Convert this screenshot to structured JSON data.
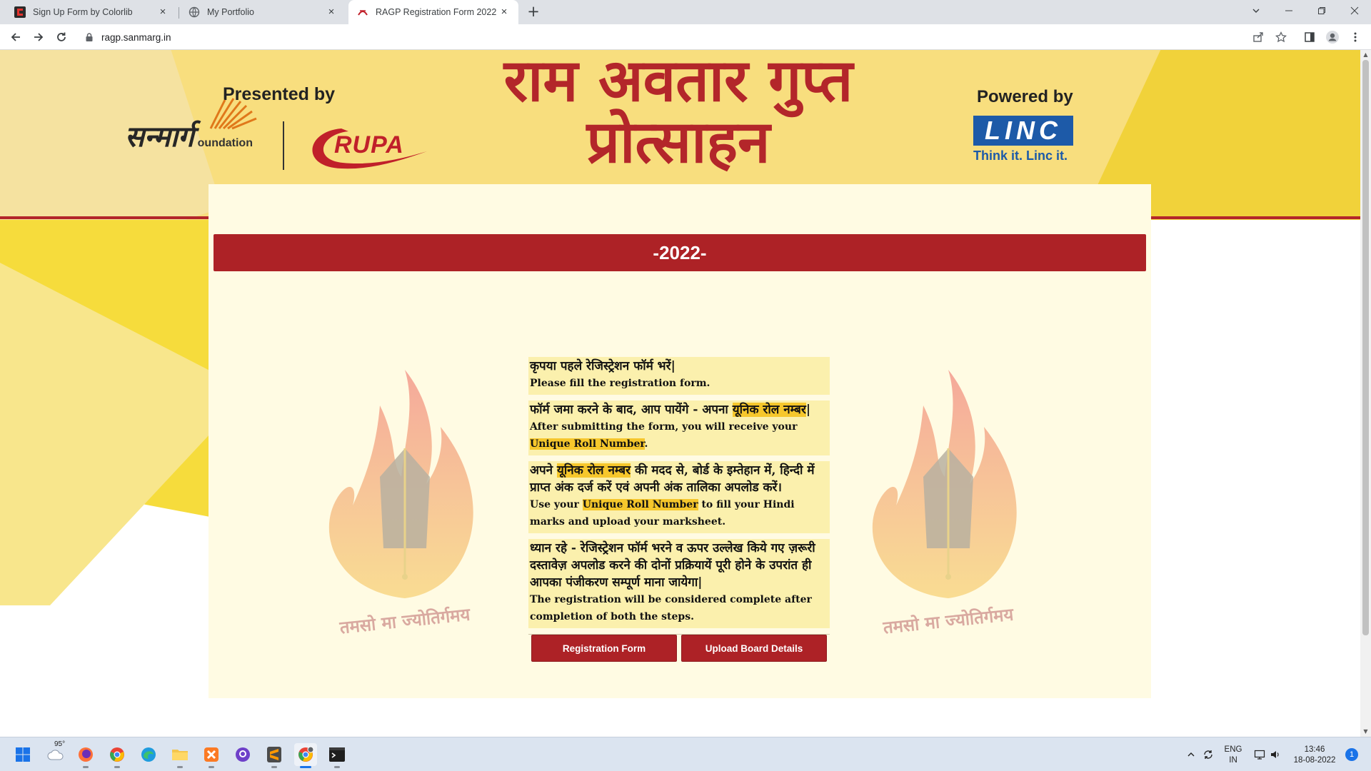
{
  "browser": {
    "tabs": [
      {
        "title": "Sign Up Form by Colorlib",
        "active": false
      },
      {
        "title": "My Portfolio",
        "active": false
      },
      {
        "title": "RAGP Registration Form 2022",
        "active": true
      }
    ],
    "url": "ragp.sanmarg.in",
    "accent": "#1a73e8"
  },
  "banner": {
    "presented_by": "Presented by",
    "sanmarg_logo_dev": "सन्मार्ग",
    "sanmarg_logo_eng": "oundation",
    "rupa_logo": "RUPA",
    "title_line1": "राम अवतार गुप्त",
    "title_line2": "प्रोत्साहन",
    "powered_by": "Powered by",
    "linc_logo": "LINC",
    "linc_tagline": "Think it. Linc it.",
    "colors": {
      "brand_red": "#ad2226",
      "banner_yellow": "#f8de7e",
      "linc_blue": "#1d5aa8"
    }
  },
  "year_banner": "-2022-",
  "emblem_motto": "तमसो मा ज्योतिर्गमय",
  "info": {
    "b1_hi": "कृपया पहले रेजिस्ट्रेशन फॉर्म भरें|",
    "b1_en": "Please fill the registration form.",
    "b2_hi_pre": "फॉर्म जमा करने के बाद, आप पायेंगे - अपना ",
    "b2_hi_hl": "यूनिक रोल नम्बर",
    "b2_hi_post": "|",
    "b2_en_pre": "After submitting the form, you will receive your ",
    "b2_en_hl": "Unique Roll Number",
    "b2_en_post": ".",
    "b3_hi_pre": "अपने ",
    "b3_hi_hl": "यूनिक रोल नम्बर",
    "b3_hi_post": " की मदद से, बोर्ड के इम्तेहान में, हिन्दी में प्राप्त अंक दर्ज करें एवं अपनी अंक तालिका अपलोड करें।",
    "b3_en_pre": "Use your ",
    "b3_en_hl": "Unique Roll Number",
    "b3_en_post": " to fill your Hindi marks and upload your marksheet.",
    "b4_hi": "ध्यान रहे - रेजिस्ट्रेशन फॉर्म भरने व ऊपर उल्लेख किये गए ज़रूरी दस्तावेज़ अपलोड करने की दोनों प्रक्रियायें पूरी होने के उपरांत ही आपका पंजीकरण सम्पूर्ण माना जायेगा|",
    "b4_en": "The registration will be considered complete after completion of both the steps."
  },
  "buttons": {
    "registration": "Registration Form",
    "upload": "Upload Board Details"
  },
  "taskbar": {
    "weather": "95°",
    "lang_top": "ENG",
    "lang_bottom": "IN",
    "time": "13:46",
    "date": "18-08-2022",
    "notifications": "1"
  }
}
